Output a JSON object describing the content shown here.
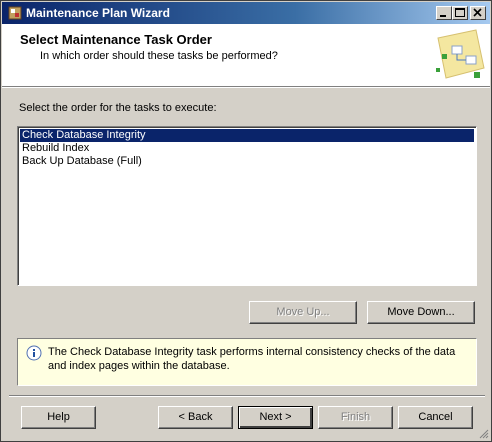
{
  "window": {
    "title": "Maintenance Plan Wizard",
    "controls": [
      "minimize-icon",
      "maximize-icon",
      "close-icon"
    ]
  },
  "header": {
    "title": "Select Maintenance Task Order",
    "subtitle": "In which order should these tasks be performed?"
  },
  "content": {
    "prompt": "Select the order for the tasks to execute:",
    "tasks": [
      {
        "label": "Check Database Integrity",
        "selected": true
      },
      {
        "label": "Rebuild Index",
        "selected": false
      },
      {
        "label": "Back Up Database (Full)",
        "selected": false
      }
    ],
    "move_up_label": "Move Up...",
    "move_up_enabled": false,
    "move_down_label": "Move Down...",
    "move_down_enabled": true
  },
  "info": {
    "icon": "info-icon",
    "text": "The Check Database Integrity task performs internal consistency checks of the data and index pages within the database."
  },
  "footer": {
    "help_label": "Help",
    "back_label": "< Back",
    "next_label": "Next >",
    "finish_label": "Finish",
    "finish_enabled": false,
    "cancel_label": "Cancel"
  },
  "colors": {
    "titlebar": "#0a246a",
    "selection": "#0a246a",
    "info_background": "#ffffe1",
    "face": "#d4d0c8"
  }
}
